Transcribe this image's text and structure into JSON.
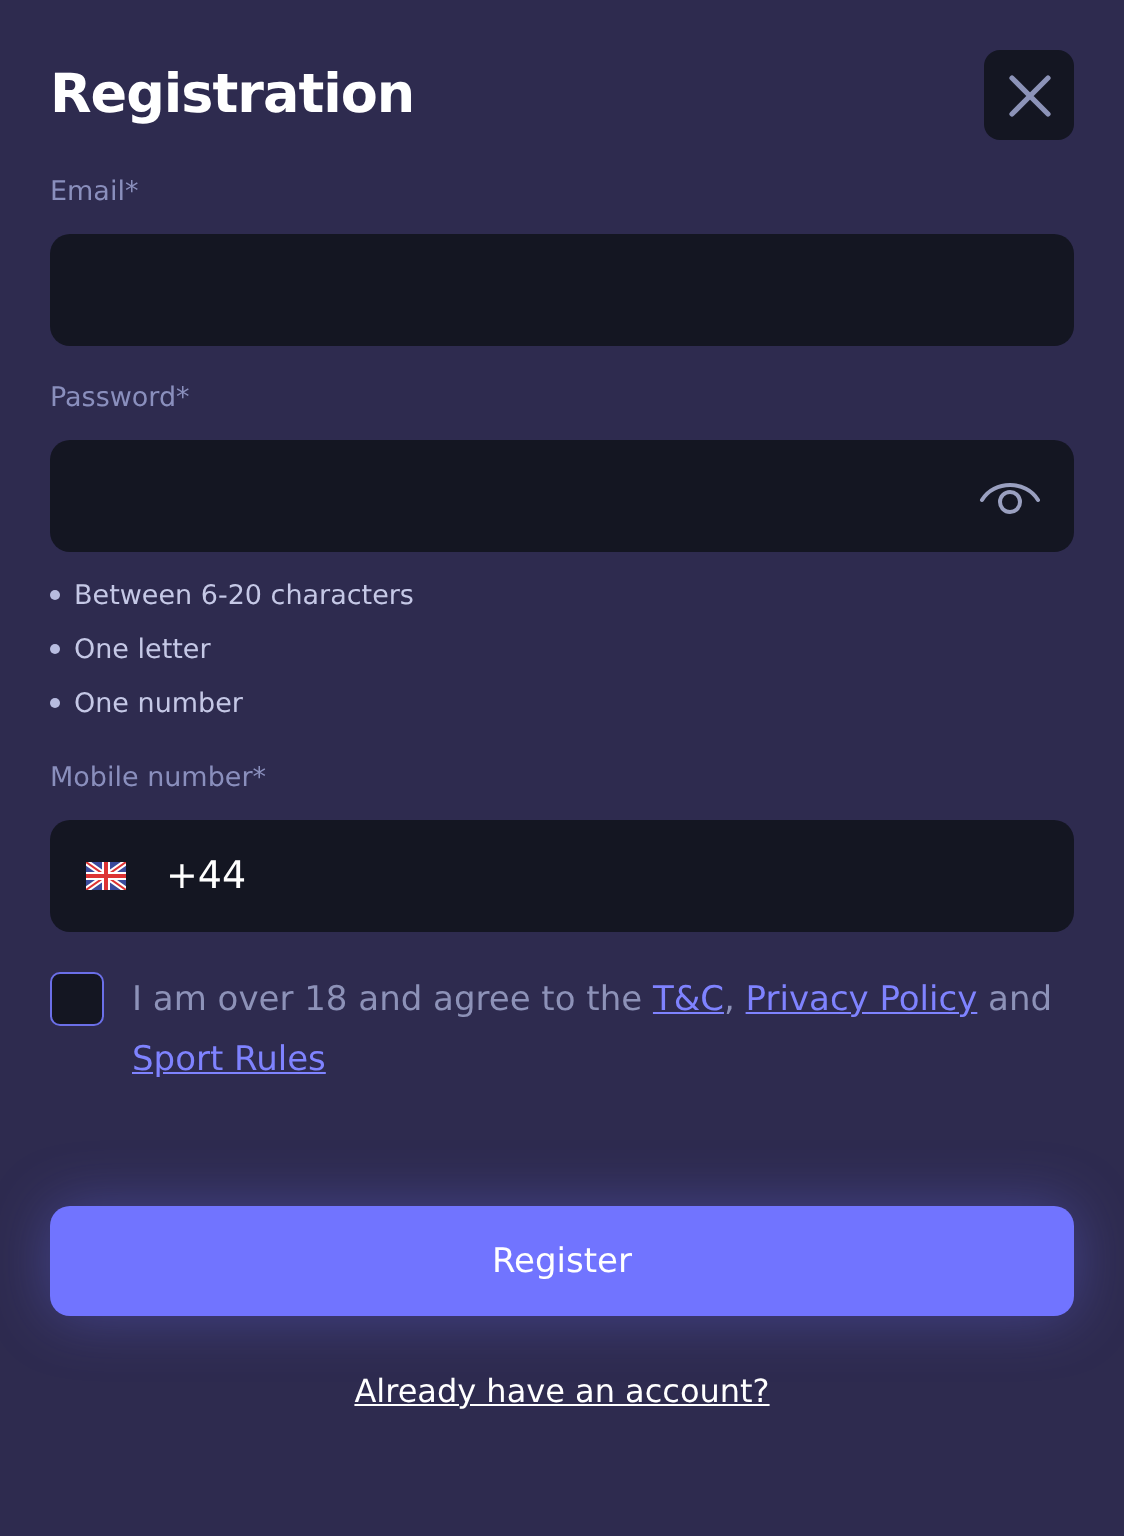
{
  "title": "Registration",
  "fields": [
    {
      "kind": "email",
      "label": "Email*"
    },
    {
      "kind": "password",
      "label": "Password*",
      "hints": [
        "Between 6-20 characters",
        "One letter",
        "One number"
      ]
    },
    {
      "kind": "phone",
      "label": "Mobile number*",
      "value": "+44"
    }
  ],
  "agreement": {
    "checked": false,
    "parts": [
      {
        "kind": "text",
        "text": "I am over 18 and agree to the "
      },
      {
        "kind": "link",
        "text": "T&C"
      },
      {
        "kind": "text",
        "text": ", "
      },
      {
        "kind": "link",
        "text": "Privacy Policy"
      },
      {
        "kind": "text",
        "text": " and "
      },
      {
        "kind": "link",
        "text": "Sport Rules"
      }
    ]
  },
  "submit": {
    "label": "Register"
  },
  "login_link": {
    "label": "Already have an account?"
  }
}
